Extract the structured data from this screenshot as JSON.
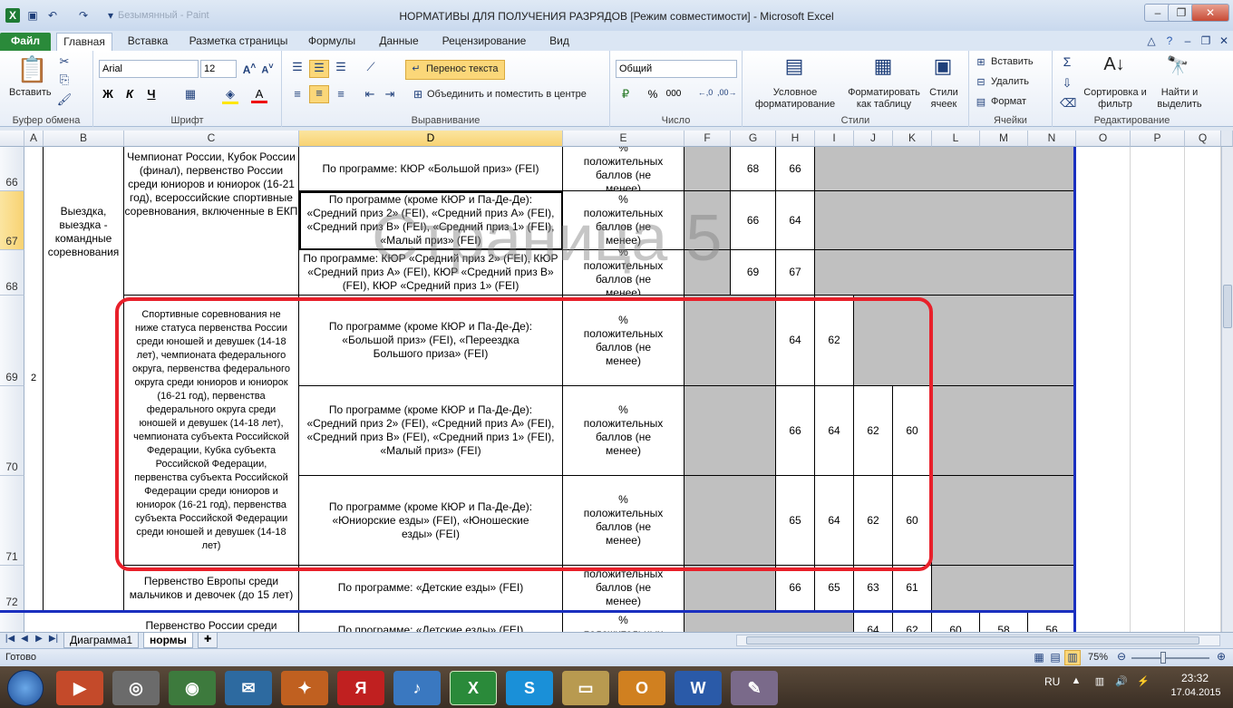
{
  "window": {
    "title": "НОРМАТИВЫ ДЛЯ ПОЛУЧЕНИЯ РАЗРЯДОВ  [Режим совместимости]  -  Microsoft Excel",
    "faded_title": "Безымянный - Paint"
  },
  "tabs": [
    "Файл",
    "Главная",
    "Вставка",
    "Разметка страницы",
    "Формулы",
    "Данные",
    "Рецензирование",
    "Вид"
  ],
  "ribbon": {
    "clipboard": {
      "paste": "Вставить",
      "label": "Буфер обмена"
    },
    "font": {
      "name": "Arial",
      "size": "12",
      "bold": "Ж",
      "italic": "К",
      "underline": "Ч",
      "label": "Шрифт"
    },
    "alignment": {
      "wrap": "Перенос текста",
      "merge": "Объединить и поместить в центре",
      "label": "Выравнивание"
    },
    "number": {
      "format": "Общий",
      "percent": "%",
      "thousands": "000",
      "label": "Число"
    },
    "styles": {
      "conditional": "Условное форматирование",
      "table": "Форматировать как таблицу",
      "cell_styles": "Стили ячеек",
      "label": "Стили"
    },
    "cells": {
      "insert": "Вставить",
      "delete": "Удалить",
      "format": "Формат",
      "label": "Ячейки"
    },
    "editing": {
      "sort": "Сортировка и фильтр",
      "find": "Найти и выделить",
      "label": "Редактирование"
    }
  },
  "columns": [
    "A",
    "B",
    "C",
    "D",
    "E",
    "F",
    "G",
    "H",
    "I",
    "J",
    "K",
    "L",
    "M",
    "N",
    "O",
    "P",
    "Q"
  ],
  "rows": [
    "66",
    "67",
    "68",
    "69",
    "70",
    "71",
    "72"
  ],
  "watermark": "Страница 5",
  "cells": {
    "a_num": "2",
    "b_group": "Выездка, выездка - командные соревнования",
    "c_top": "Чемпионат России, Кубок России (финал), первенство России среди юниоров и юниорок (16-21 год), всероссийские спортивные соревнования, включенные в ЕКП",
    "c_mid": "Спортивные соревнования не ниже статуса первенства России среди юношей и девушек (14-18 лет), чемпионата федерального округа, первенства федерального округа среди юниоров и юниорок (16-21 год), первенства федерального округа среди юношей и девушек (14-18 лет), чемпионата субъекта Российской Федерации, Кубка субъекта Российской Федерации, первенства субъекта Российской Федерации среди юниоров и юниорок (16-21 год), первенства субъекта Российской Федерации среди юношей и девушек (14-18 лет)",
    "c_72": "Первенство Европы среди мальчиков и девочек (до 15 лет)",
    "c_next": "Первенство России среди",
    "d66": "По программе: КЮР «Большой приз» (FEI)",
    "d67": "По программе (кроме КЮР и Па-Де-Де): «Средний приз 2» (FEI), «Средний приз А» (FEI), «Средний приз В» (FEI), «Средний приз 1» (FEI), «Малый приз» (FEI)",
    "d68": "По программе: КЮР «Средний приз 2» (FEI), КЮР «Средний приз А» (FEI), КЮР «Средний приз В» (FEI), КЮР «Средний приз 1» (FEI)",
    "d69": "По программе (кроме КЮР и Па-Де-Де): «Большой приз» (FEI), «Переездка Большого приза» (FEI)",
    "d70": "По программе (кроме КЮР и Па-Де-Де): «Средний приз 2» (FEI), «Средний приз А» (FEI), «Средний приз В» (FEI), «Средний приз 1» (FEI), «Малый приз» (FEI)",
    "d71": "По программе (кроме КЮР и Па-Де-Де): «Юниорские езды» (FEI), «Юношеские езды» (FEI)",
    "d72": "По программе: «Детские езды» (FEI)",
    "d_next": "По программе: «Детские езды» (FEI)",
    "e": "% положительных баллов (не менее)",
    "e_next": "% положительных баллов",
    "r66": {
      "g": "68",
      "h": "66"
    },
    "r67": {
      "g": "66",
      "h": "64"
    },
    "r68": {
      "g": "69",
      "h": "67"
    },
    "r69": {
      "h": "64",
      "i": "62"
    },
    "r70": {
      "h": "66",
      "i": "64",
      "j": "62",
      "k": "60"
    },
    "r71": {
      "h": "65",
      "i": "64",
      "j": "62",
      "k": "60"
    },
    "r72": {
      "h": "66",
      "i": "65",
      "j": "63",
      "k": "61"
    },
    "r_next": {
      "j": "64",
      "k": "62",
      "l": "60",
      "m": "58",
      "n": "56"
    }
  },
  "sheets": [
    "Диаграмма1",
    "нормы"
  ],
  "status": {
    "ready": "Готово",
    "zoom": "75%"
  },
  "taskbar": {
    "lang": "RU",
    "time": "23:32",
    "date": "17.04.2015"
  },
  "colors": {
    "accent_red": "#e8202a",
    "excel_green": "#2a8a3a"
  }
}
